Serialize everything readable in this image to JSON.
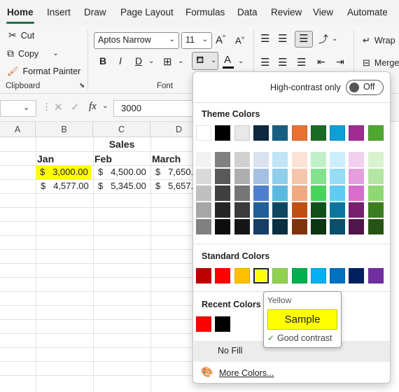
{
  "tabs": [
    "Home",
    "Insert",
    "Draw",
    "Page Layout",
    "Formulas",
    "Data",
    "Review",
    "View",
    "Automate"
  ],
  "clipboard": {
    "cut": "Cut",
    "copy": "Copy",
    "format_painter": "Format Painter",
    "group": "Clipboard"
  },
  "font": {
    "name": "Aptos Narrow",
    "size": "11",
    "group": "Font",
    "grow": "A",
    "shrink": "A"
  },
  "format_buttons": {
    "bold": "B",
    "italic": "I",
    "underline": "D"
  },
  "alignment": {
    "wrap": "Wrap",
    "merge": "Merge"
  },
  "formula_bar": {
    "fx": "fx",
    "value": "3000"
  },
  "columns": [
    "A",
    "B",
    "C",
    "D"
  ],
  "sheet": {
    "title": "Sales",
    "headers": [
      "Jan",
      "Feb",
      "March"
    ],
    "row1": [
      "$   3,000.00",
      "$   4,500.00",
      "$   7,650."
    ],
    "row2": [
      "$   4,577.00",
      "$   5,345.00",
      "$   5,657."
    ],
    "highlight_color": "#ffff00"
  },
  "panel": {
    "high_contrast_label": "High-contrast only",
    "toggle_state": "Off",
    "theme_title": "Theme Colors",
    "standard_title": "Standard Colors",
    "recent_title": "Recent Colors",
    "no_fill": "No Fill",
    "more_colors": "More Colors...",
    "theme_top": [
      "#ffffff",
      "#000000",
      "#e8e8e8",
      "#0e2841",
      "#156082",
      "#e97132",
      "#196b24",
      "#0f9ed5",
      "#a02b93",
      "#4ea72e"
    ],
    "theme_shades": [
      [
        "#f2f2f2",
        "#808080",
        "#d0d0d0",
        "#dae2f0",
        "#c0e4f5",
        "#fbe2d5",
        "#c1f0c8",
        "#caeefb",
        "#f2ceef",
        "#d9f2d0"
      ],
      [
        "#d9d9d9",
        "#595959",
        "#aeaeae",
        "#a6c0e4",
        "#8fcfeb",
        "#f6c5ac",
        "#83e28e",
        "#95dcf7",
        "#e59edd",
        "#b4e5a2"
      ],
      [
        "#bfbfbf",
        "#404040",
        "#757575",
        "#4f80cf",
        "#5bb9e0",
        "#f1a983",
        "#47d45a",
        "#60cbf3",
        "#d86dcd",
        "#8ed973"
      ],
      [
        "#a6a6a6",
        "#262626",
        "#3b3b3b",
        "#215f9a",
        "#0f4761",
        "#c04f15",
        "#124f1a",
        "#0b769f",
        "#782070",
        "#3a7d22"
      ],
      [
        "#808080",
        "#0d0d0d",
        "#161616",
        "#163e64",
        "#0a2f40",
        "#80340e",
        "#0d3512",
        "#074f6a",
        "#501549",
        "#275317"
      ]
    ],
    "standard": [
      "#c00000",
      "#ff0000",
      "#ffc000",
      "#ffff00",
      "#92d050",
      "#00b050",
      "#00b0f0",
      "#0070c0",
      "#002060",
      "#7030a0"
    ],
    "recent": [
      "#ff0000",
      "#000000"
    ]
  },
  "tooltip": {
    "name": "Yellow",
    "sample": "Sample",
    "contrast": "Good contrast",
    "color": "#ffff00"
  }
}
